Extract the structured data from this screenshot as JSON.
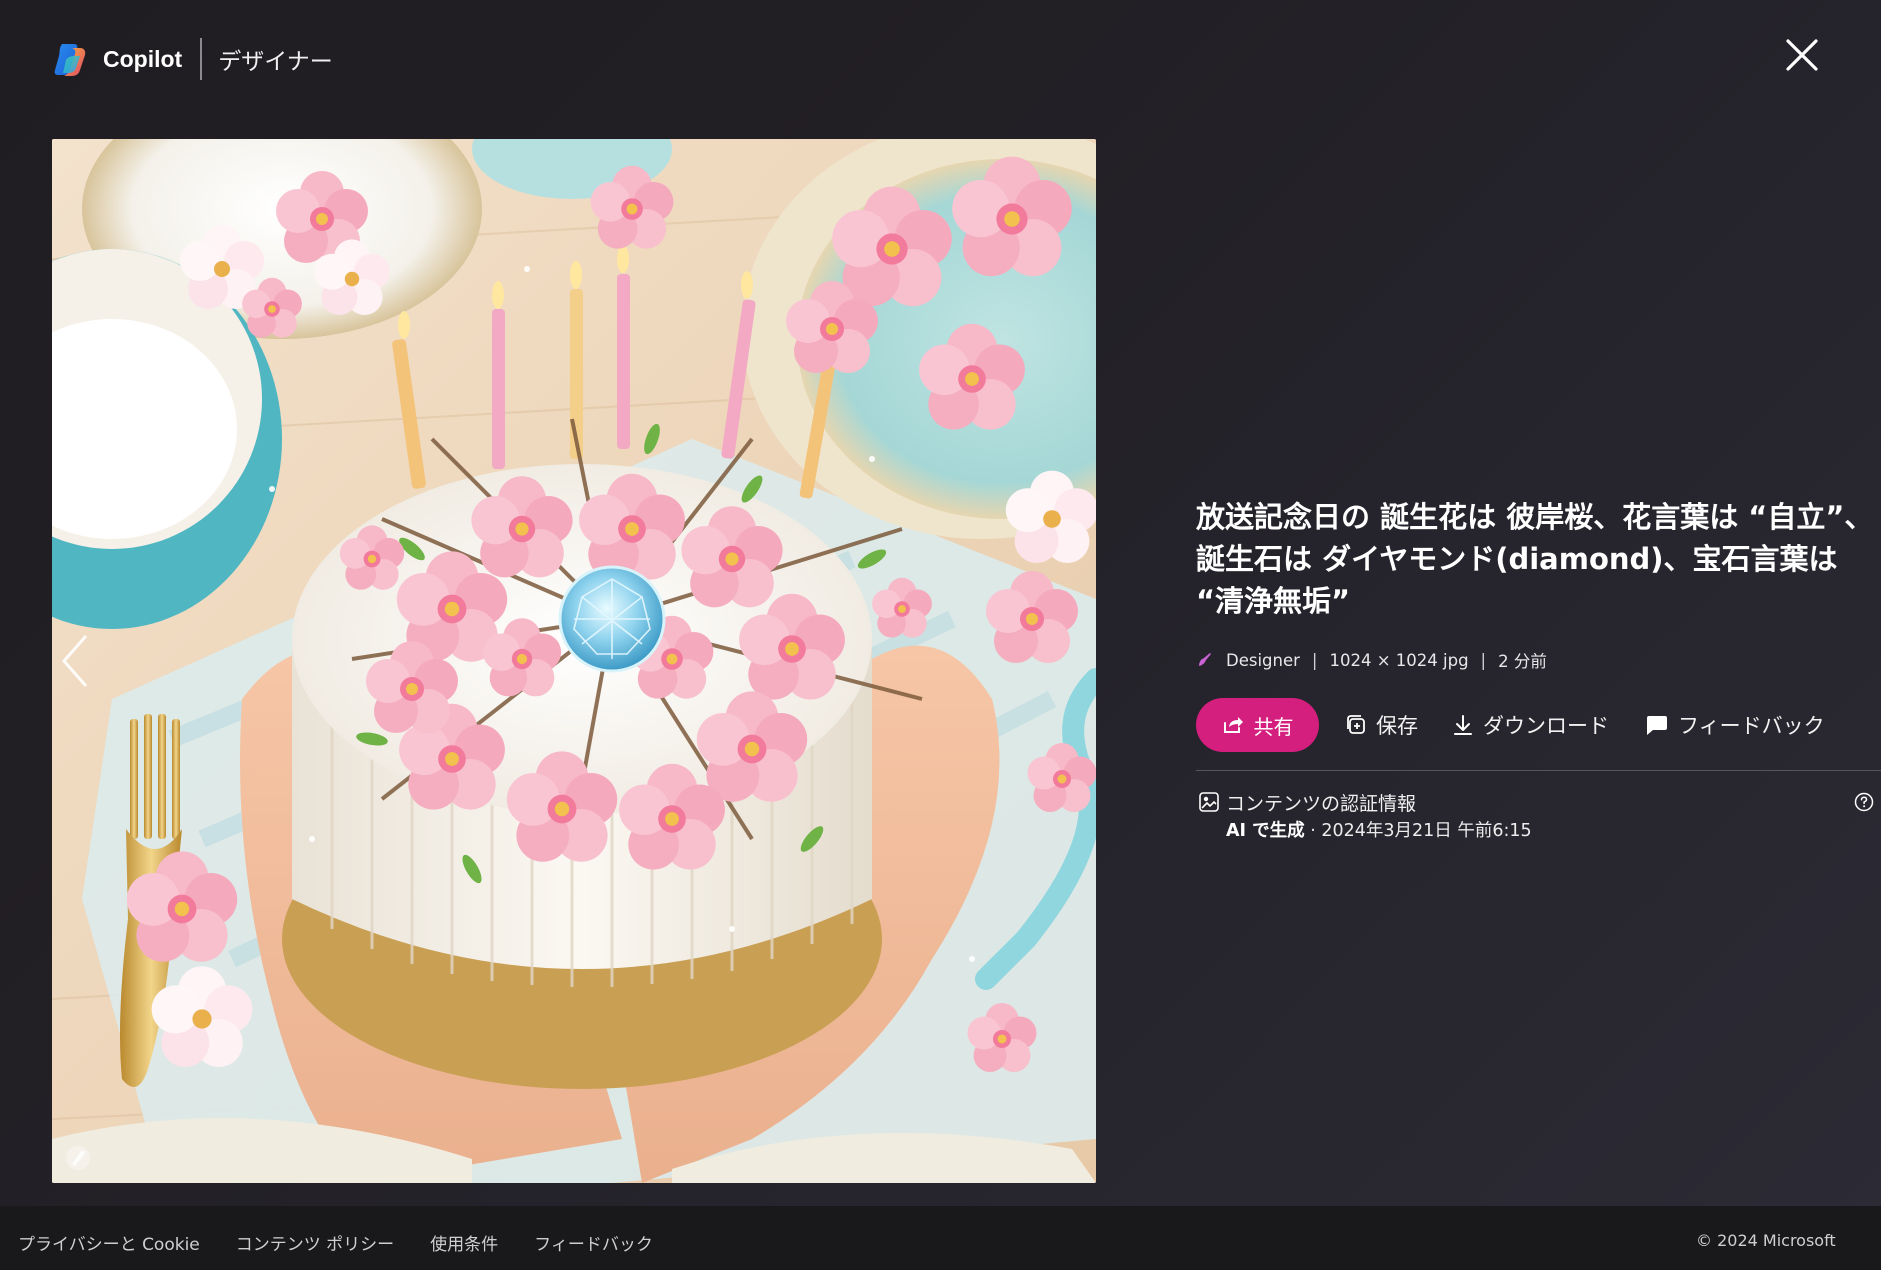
{
  "header": {
    "brand": "Copilot",
    "product": "デザイナー"
  },
  "image": {
    "alt": "放送記念日の 誕生花は 彼岸桜、花言葉は “自立”、誕生石は ダイヤモンド(diamond)、宝石言葉は “清浄無垢”"
  },
  "info": {
    "title": "放送記念日の 誕生花は 彼岸桜、花言葉は “自立”、誕生石は ダイヤモンド(diamond)、宝石言葉は “清浄無垢”",
    "meta": {
      "source": "Designer",
      "dimensions": "1024 × 1024 jpg",
      "time": "2 分前"
    },
    "actions": {
      "share": "共有",
      "save": "保存",
      "download": "ダウンロード",
      "feedback": "フィードバック"
    },
    "provenance": {
      "title": "コンテンツの認証情報",
      "generated": "AI で生成",
      "date": " · 2024年3月21日 午前6:15"
    }
  },
  "footer": {
    "links": [
      "プライバシーと Cookie",
      "コンテンツ ポリシー",
      "使用条件",
      "フィードバック"
    ],
    "copyright": "© 2024 Microsoft"
  },
  "colors": {
    "accent": "#d41f7e",
    "background": "#221f25",
    "footer": "#19181b"
  }
}
